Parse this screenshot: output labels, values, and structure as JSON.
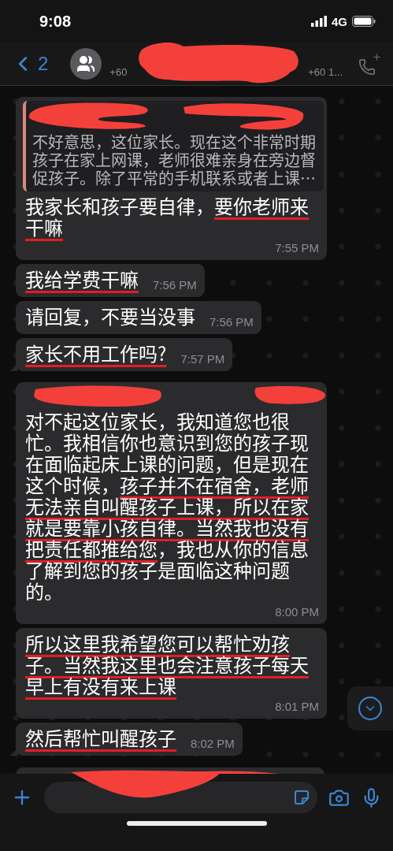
{
  "status_bar": {
    "time": "9:08",
    "network": "4G"
  },
  "header": {
    "back_count": "2",
    "subtitle_start": "+60",
    "subtitle_end": "+60 1..."
  },
  "messages": [
    {
      "quote": "不好意思，这位家长。现在这个非常时期孩子在家上网课，老师很难亲身在旁边督促孩子。除了平常的手机联系或者上课…",
      "segments": [
        {
          "text": "我家长和孩子要自律，",
          "underlined": false
        },
        {
          "text": "要你老师来干嘛",
          "underlined": true
        }
      ],
      "time": "7:55 PM",
      "tail": false,
      "hidden_sender": false
    },
    {
      "segments": [
        {
          "text": "我给学费干嘛",
          "underlined": true
        }
      ],
      "time": "7:56 PM",
      "tail": false,
      "hidden_sender": false
    },
    {
      "segments": [
        {
          "text": "请回复，不要当没事",
          "underlined": false
        }
      ],
      "time": "7:56 PM",
      "tail": false,
      "hidden_sender": false
    },
    {
      "segments": [
        {
          "text": "家长不用工作吗?",
          "underlined": true
        }
      ],
      "time": "7:57 PM",
      "tail": true,
      "hidden_sender": false
    },
    {
      "segments": [
        {
          "text": "对不起这位家长，我知道您也很忙。我相信你也意识到您的孩子现在面临起床上课的问题，但是现在这个时候，",
          "underlined": false
        },
        {
          "text": "孩子并不在宿舍，老师无法亲自叫醒孩子上课，所以在家就是要靠小孩自律。当然我也没有把责任都推给您",
          "underlined": true
        },
        {
          "text": "，我也从你的信息了解到您的孩子是面临这种问题的。",
          "underlined": false
        }
      ],
      "time": "8:00 PM",
      "tail": false,
      "hidden_sender": true
    },
    {
      "segments": [
        {
          "text": "所以这里我希望您可以帮忙劝孩子。当然我这里也会注意孩子每天早上有没有来上课",
          "underlined": true
        }
      ],
      "time": "8:01 PM",
      "tail": false,
      "hidden_sender": false
    },
    {
      "segments": [
        {
          "text": "然后帮忙叫醒孩子",
          "underlined": true
        }
      ],
      "time": "8:02 PM",
      "tail": true,
      "hidden_sender": false
    }
  ]
}
